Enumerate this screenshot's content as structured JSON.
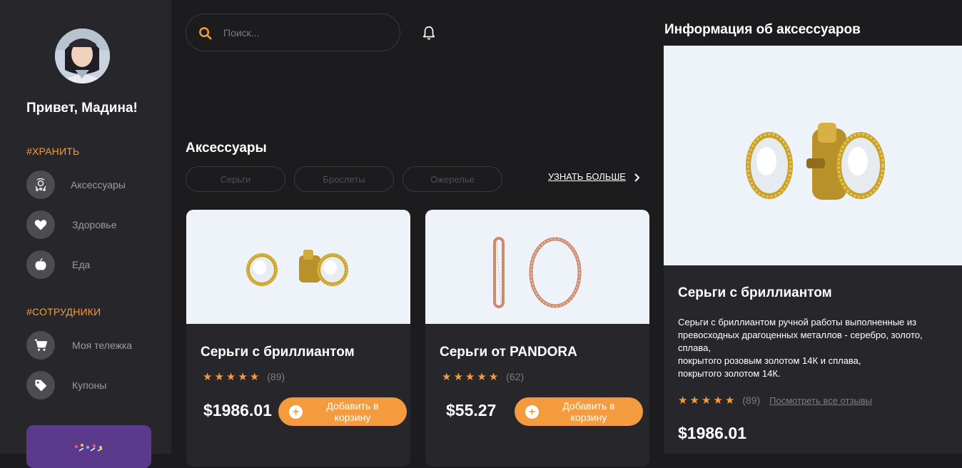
{
  "sidebar": {
    "greeting": "Привет, Мадина!",
    "sections": [
      {
        "label": "#ХРАНИТЬ",
        "items": [
          {
            "label": "Аксессуары",
            "icon": "jewelry-icon"
          },
          {
            "label": "Здоровье",
            "icon": "heart-icon"
          },
          {
            "label": "Еда",
            "icon": "apple-icon"
          }
        ]
      },
      {
        "label": "#СОТРУДНИКИ",
        "items": [
          {
            "label": "Моя тележка",
            "icon": "cart-icon"
          },
          {
            "label": "Купоны",
            "icon": "tag-icon"
          }
        ]
      }
    ]
  },
  "search": {
    "placeholder": "Поиск..."
  },
  "main": {
    "title": "Аксессуары",
    "chips": [
      "Серьги",
      "Брослеты",
      "Ожерелье"
    ],
    "learn_more": "УЗНАТЬ БОЛЬШЕ",
    "products": [
      {
        "title": "Серьги с бриллиантом",
        "rating": 5,
        "reviews": "(89)",
        "price": "$1986.01",
        "button": "Добавить в корзину"
      },
      {
        "title": "Серьги от PANDORA",
        "rating": 5,
        "reviews": "(62)",
        "price": "$55.27",
        "button": "Добавить в корзину"
      }
    ]
  },
  "detail": {
    "heading": "Информация об аксессуаров",
    "title": "Серьги с бриллиантом",
    "description_lines": [
      "Серьги с бриллиантом ручной работы выполненные из",
      "превосходных драгоценных металлов - серебро, золото, сплава,",
      "покрытого розовым золотом 14К и сплава,",
      "покрытого золотом 14К."
    ],
    "rating": 5,
    "reviews": "(89)",
    "reviews_link": "Посмотреть все отзывы",
    "price": "$1986.01"
  },
  "colors": {
    "accent": "#f59b3f",
    "background": "#1c1b1e",
    "panel": "#27262b",
    "product_bg": "#eef3f9"
  }
}
